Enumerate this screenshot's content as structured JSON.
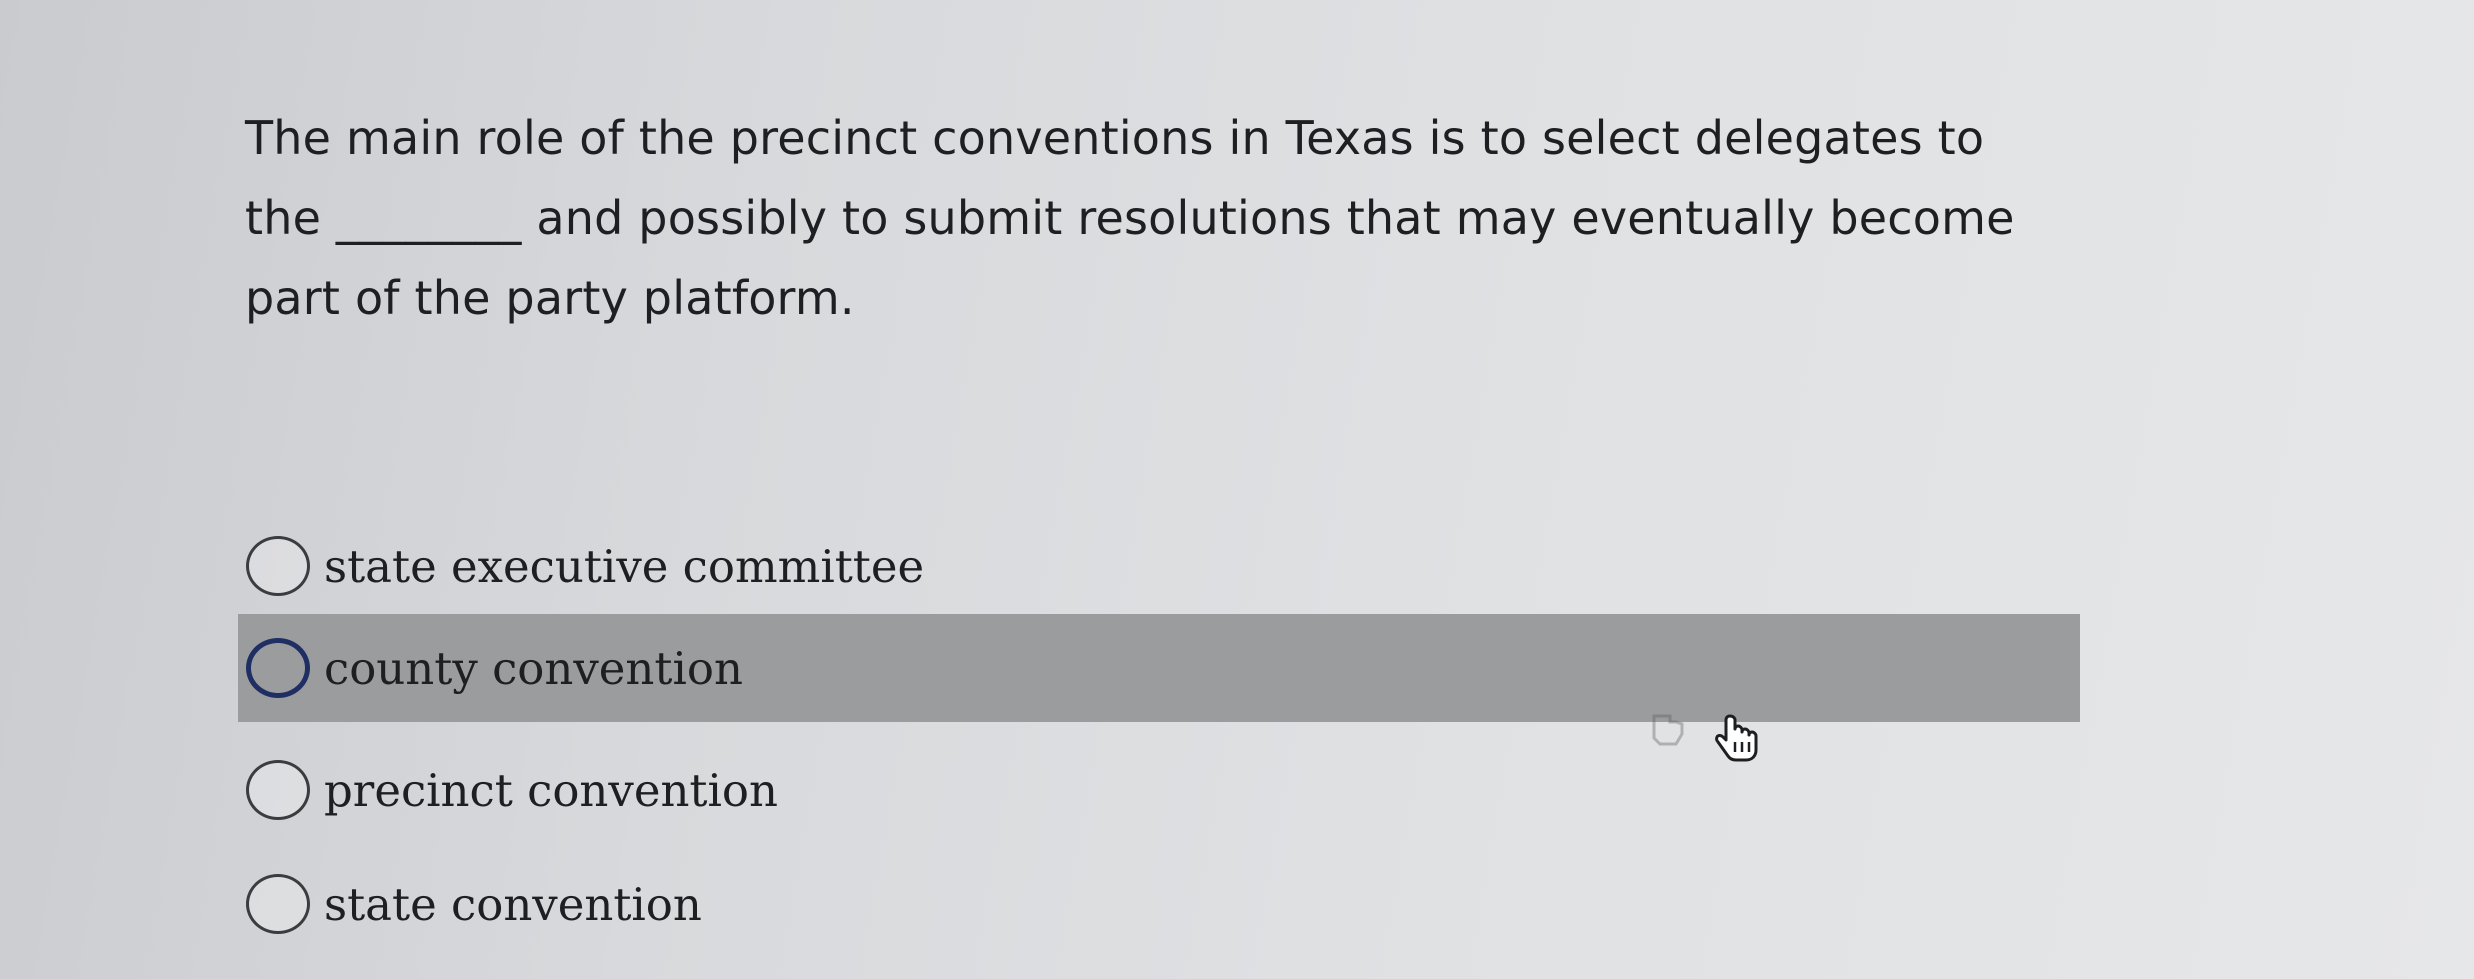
{
  "question": {
    "line1": "The main role of the precinct conventions in Texas is to select delegates to",
    "line2": "the ________ and possibly to submit resolutions that may eventually become",
    "line3": "part of the party platform."
  },
  "options": [
    {
      "label": "state executive committee",
      "highlighted": false
    },
    {
      "label": "county convention",
      "highlighted": true
    },
    {
      "label": "precinct convention",
      "highlighted": false
    },
    {
      "label": "state convention",
      "highlighted": false
    }
  ],
  "cursor_icon": "hand-pointer-icon",
  "colors": {
    "highlight": "#9b9c9e",
    "radio_focus": "#1f2f63",
    "text": "#1d1f22"
  }
}
